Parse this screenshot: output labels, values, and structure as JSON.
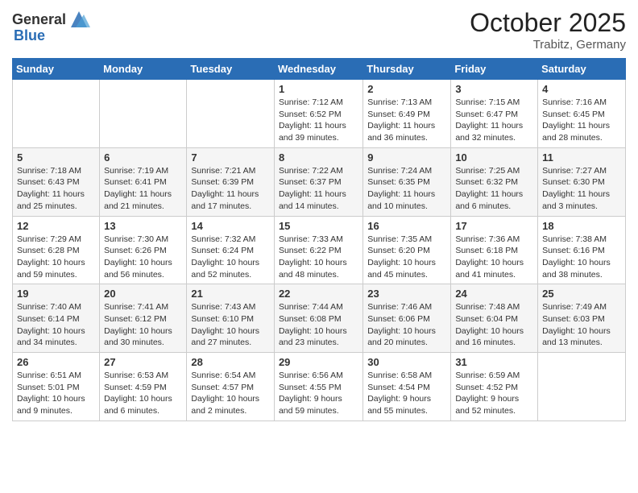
{
  "header": {
    "logo_general": "General",
    "logo_blue": "Blue",
    "month": "October 2025",
    "location": "Trabitz, Germany"
  },
  "weekdays": [
    "Sunday",
    "Monday",
    "Tuesday",
    "Wednesday",
    "Thursday",
    "Friday",
    "Saturday"
  ],
  "weeks": [
    [
      {
        "day": "",
        "info": ""
      },
      {
        "day": "",
        "info": ""
      },
      {
        "day": "",
        "info": ""
      },
      {
        "day": "1",
        "info": "Sunrise: 7:12 AM\nSunset: 6:52 PM\nDaylight: 11 hours\nand 39 minutes."
      },
      {
        "day": "2",
        "info": "Sunrise: 7:13 AM\nSunset: 6:49 PM\nDaylight: 11 hours\nand 36 minutes."
      },
      {
        "day": "3",
        "info": "Sunrise: 7:15 AM\nSunset: 6:47 PM\nDaylight: 11 hours\nand 32 minutes."
      },
      {
        "day": "4",
        "info": "Sunrise: 7:16 AM\nSunset: 6:45 PM\nDaylight: 11 hours\nand 28 minutes."
      }
    ],
    [
      {
        "day": "5",
        "info": "Sunrise: 7:18 AM\nSunset: 6:43 PM\nDaylight: 11 hours\nand 25 minutes."
      },
      {
        "day": "6",
        "info": "Sunrise: 7:19 AM\nSunset: 6:41 PM\nDaylight: 11 hours\nand 21 minutes."
      },
      {
        "day": "7",
        "info": "Sunrise: 7:21 AM\nSunset: 6:39 PM\nDaylight: 11 hours\nand 17 minutes."
      },
      {
        "day": "8",
        "info": "Sunrise: 7:22 AM\nSunset: 6:37 PM\nDaylight: 11 hours\nand 14 minutes."
      },
      {
        "day": "9",
        "info": "Sunrise: 7:24 AM\nSunset: 6:35 PM\nDaylight: 11 hours\nand 10 minutes."
      },
      {
        "day": "10",
        "info": "Sunrise: 7:25 AM\nSunset: 6:32 PM\nDaylight: 11 hours\nand 6 minutes."
      },
      {
        "day": "11",
        "info": "Sunrise: 7:27 AM\nSunset: 6:30 PM\nDaylight: 11 hours\nand 3 minutes."
      }
    ],
    [
      {
        "day": "12",
        "info": "Sunrise: 7:29 AM\nSunset: 6:28 PM\nDaylight: 10 hours\nand 59 minutes."
      },
      {
        "day": "13",
        "info": "Sunrise: 7:30 AM\nSunset: 6:26 PM\nDaylight: 10 hours\nand 56 minutes."
      },
      {
        "day": "14",
        "info": "Sunrise: 7:32 AM\nSunset: 6:24 PM\nDaylight: 10 hours\nand 52 minutes."
      },
      {
        "day": "15",
        "info": "Sunrise: 7:33 AM\nSunset: 6:22 PM\nDaylight: 10 hours\nand 48 minutes."
      },
      {
        "day": "16",
        "info": "Sunrise: 7:35 AM\nSunset: 6:20 PM\nDaylight: 10 hours\nand 45 minutes."
      },
      {
        "day": "17",
        "info": "Sunrise: 7:36 AM\nSunset: 6:18 PM\nDaylight: 10 hours\nand 41 minutes."
      },
      {
        "day": "18",
        "info": "Sunrise: 7:38 AM\nSunset: 6:16 PM\nDaylight: 10 hours\nand 38 minutes."
      }
    ],
    [
      {
        "day": "19",
        "info": "Sunrise: 7:40 AM\nSunset: 6:14 PM\nDaylight: 10 hours\nand 34 minutes."
      },
      {
        "day": "20",
        "info": "Sunrise: 7:41 AM\nSunset: 6:12 PM\nDaylight: 10 hours\nand 30 minutes."
      },
      {
        "day": "21",
        "info": "Sunrise: 7:43 AM\nSunset: 6:10 PM\nDaylight: 10 hours\nand 27 minutes."
      },
      {
        "day": "22",
        "info": "Sunrise: 7:44 AM\nSunset: 6:08 PM\nDaylight: 10 hours\nand 23 minutes."
      },
      {
        "day": "23",
        "info": "Sunrise: 7:46 AM\nSunset: 6:06 PM\nDaylight: 10 hours\nand 20 minutes."
      },
      {
        "day": "24",
        "info": "Sunrise: 7:48 AM\nSunset: 6:04 PM\nDaylight: 10 hours\nand 16 minutes."
      },
      {
        "day": "25",
        "info": "Sunrise: 7:49 AM\nSunset: 6:03 PM\nDaylight: 10 hours\nand 13 minutes."
      }
    ],
    [
      {
        "day": "26",
        "info": "Sunrise: 6:51 AM\nSunset: 5:01 PM\nDaylight: 10 hours\nand 9 minutes."
      },
      {
        "day": "27",
        "info": "Sunrise: 6:53 AM\nSunset: 4:59 PM\nDaylight: 10 hours\nand 6 minutes."
      },
      {
        "day": "28",
        "info": "Sunrise: 6:54 AM\nSunset: 4:57 PM\nDaylight: 10 hours\nand 2 minutes."
      },
      {
        "day": "29",
        "info": "Sunrise: 6:56 AM\nSunset: 4:55 PM\nDaylight: 9 hours\nand 59 minutes."
      },
      {
        "day": "30",
        "info": "Sunrise: 6:58 AM\nSunset: 4:54 PM\nDaylight: 9 hours\nand 55 minutes."
      },
      {
        "day": "31",
        "info": "Sunrise: 6:59 AM\nSunset: 4:52 PM\nDaylight: 9 hours\nand 52 minutes."
      },
      {
        "day": "",
        "info": ""
      }
    ]
  ]
}
